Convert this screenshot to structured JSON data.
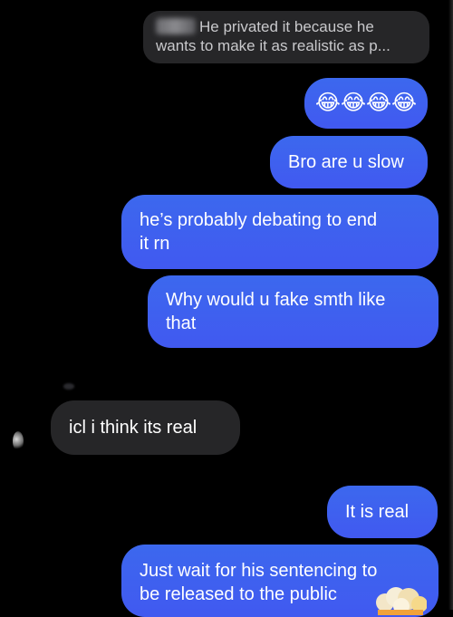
{
  "reply_preview": {
    "text_line1": "He privated it because he",
    "text_line2": "wants to make it as realistic as p..."
  },
  "messages": [
    {
      "side": "out",
      "text": "😂😂😂😂"
    },
    {
      "side": "out",
      "text": "Bro are u slow"
    },
    {
      "side": "out",
      "line1": "he’s probably debating to end",
      "line2": "it rn"
    },
    {
      "side": "out",
      "line1": "Why would u fake smth like",
      "line2": "that"
    },
    {
      "side": "in",
      "text": "icl i think its real"
    },
    {
      "side": "out",
      "text": "It is real"
    },
    {
      "side": "out",
      "line1": "Just wait for his sentencing to",
      "line2": "be released to the public"
    }
  ],
  "colors": {
    "outgoing_bubble": "#3f62ef",
    "incoming_bubble": "#262628",
    "background": "#000000"
  }
}
